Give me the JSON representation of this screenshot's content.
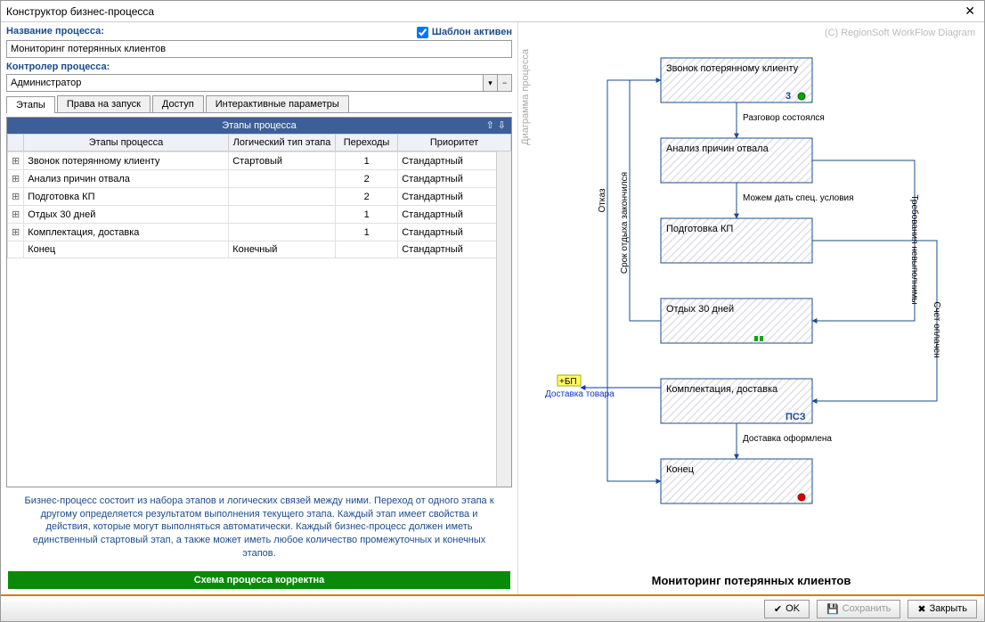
{
  "window": {
    "title": "Конструктор бизнес-процесса"
  },
  "form": {
    "name_label": "Название процесса:",
    "name_value": "Мониторинг потерянных клиентов",
    "template_active_label": "Шаблон активен",
    "controller_label": "Контролер процесса:",
    "controller_value": "Администратор"
  },
  "tabs": {
    "stages": "Этапы",
    "rights": "Права на запуск",
    "access": "Доступ",
    "params": "Интерактивные параметры"
  },
  "grid": {
    "title": "Этапы процесса",
    "headers": {
      "name": "Этапы процесса",
      "type": "Логический тип этапа",
      "trans": "Переходы",
      "priority": "Приоритет"
    },
    "rows": [
      {
        "exp": "+",
        "name": "Звонок потерянному клиенту",
        "type": "Стартовый",
        "trans": "1",
        "priority": "Стандартный"
      },
      {
        "exp": "+",
        "name": "Анализ причин отвала",
        "type": "",
        "trans": "2",
        "priority": "Стандартный"
      },
      {
        "exp": "+",
        "name": "Подготовка КП",
        "type": "",
        "trans": "2",
        "priority": "Стандартный"
      },
      {
        "exp": "+",
        "name": "Отдых 30 дней",
        "type": "",
        "trans": "1",
        "priority": "Стандартный"
      },
      {
        "exp": "+",
        "name": "Комплектация, доставка",
        "type": "",
        "trans": "1",
        "priority": "Стандартный"
      },
      {
        "exp": "",
        "name": "Конец",
        "type": "Конечный",
        "trans": "",
        "priority": "Стандартный"
      }
    ]
  },
  "hint": "Бизнес-процесс состоит из набора этапов и логических связей между ними. Переход от одного этапа к другому определяется результатом выполнения текущего этапа. Каждый этап имеет свойства и действия, которые могут выполняться автоматически. Каждый бизнес-процесс должен иметь единственный стартовый этап, а также может иметь любое количество промежуточных и конечных этапов.",
  "status": "Схема процесса корректна",
  "diagram": {
    "side_label": "Диаграмма процесса",
    "copyright": "(C) RegionSoft WorkFlow Diagram",
    "title": "Мониторинг потерянных клиентов",
    "nodes": {
      "n1": "Звонок потерянному клиенту",
      "n2": "Анализ причин отвала",
      "n3": "Подготовка КП",
      "n4": "Отдых 30 дней",
      "n5": "Комплектация, доставка",
      "n6": "Конец"
    },
    "edges": {
      "e1": "Разговор состоялся",
      "e2": "Можем дать спец. условия",
      "e3": "Требования невыполнимы",
      "e4": "Счет оплачен",
      "e5": "Доставка оформлена",
      "e6": "Отказ",
      "e7": "Срок отдыха закончился",
      "e8_tag": "+БП",
      "e8": "Доставка товара"
    },
    "badges": {
      "n1_num": "3",
      "n5_badge": "ПСЗ"
    }
  },
  "footer": {
    "ok": "OK",
    "save": "Сохранить",
    "close": "Закрыть"
  }
}
